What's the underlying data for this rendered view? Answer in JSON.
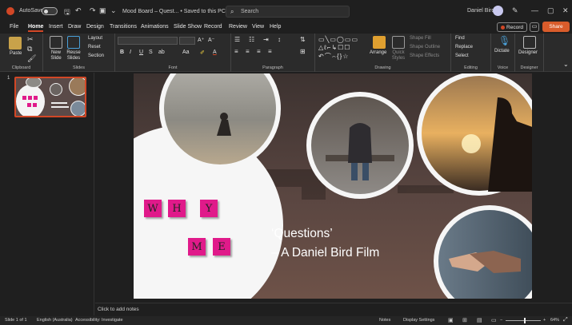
{
  "titlebar": {
    "autosave_label": "AutoSave",
    "autosave_state": "Off",
    "document_title": "Mood Board – Quest... • Saved to this PC ⌄",
    "search_placeholder": "Search",
    "user_name": "Daniel Bird"
  },
  "tabs": [
    "File",
    "Home",
    "Insert",
    "Draw",
    "Design",
    "Transitions",
    "Animations",
    "Slide Show",
    "Record",
    "Review",
    "View",
    "Help"
  ],
  "active_tab": "Home",
  "actions": {
    "record": "Record",
    "share": "Share"
  },
  "ribbon": {
    "groups": {
      "clipboard": "Clipboard",
      "slides": "Slides",
      "font": "Font",
      "paragraph": "Paragraph",
      "drawing": "Drawing",
      "editing": "Editing",
      "voice": "Voice",
      "designer": "Designer"
    },
    "buttons": {
      "paste": "Paste",
      "new_slide": "New Slide",
      "reuse_slides": "Reuse Slides",
      "layout": "Layout",
      "reset": "Reset",
      "section": "Section",
      "arrange": "Arrange",
      "quick_styles": "Quick Styles",
      "shape_fill": "Shape Fill",
      "shape_outline": "Shape Outline",
      "shape_effects": "Shape Effects",
      "find": "Find",
      "replace": "Replace",
      "select": "Select",
      "dictate": "Dictate",
      "designer": "Designer"
    }
  },
  "thumbnails": [
    {
      "number": "1"
    }
  ],
  "slide": {
    "tiles_row1": [
      "W",
      "H",
      "Y"
    ],
    "tiles_row2": [
      "M",
      "E"
    ],
    "title": "‘Questions’",
    "subtitle": "– A Daniel Bird Film"
  },
  "notes_placeholder": "Click to add notes",
  "statusbar": {
    "slide_counter": "Slide 1 of 1",
    "language": "English (Australia)",
    "accessibility": "Accessibility: Investigate",
    "notes": "Notes",
    "display_settings": "Display Settings",
    "zoom": "64%"
  },
  "colors": {
    "accent": "#d24726",
    "share": "#d95c2b",
    "tile": "#e01a8a"
  }
}
